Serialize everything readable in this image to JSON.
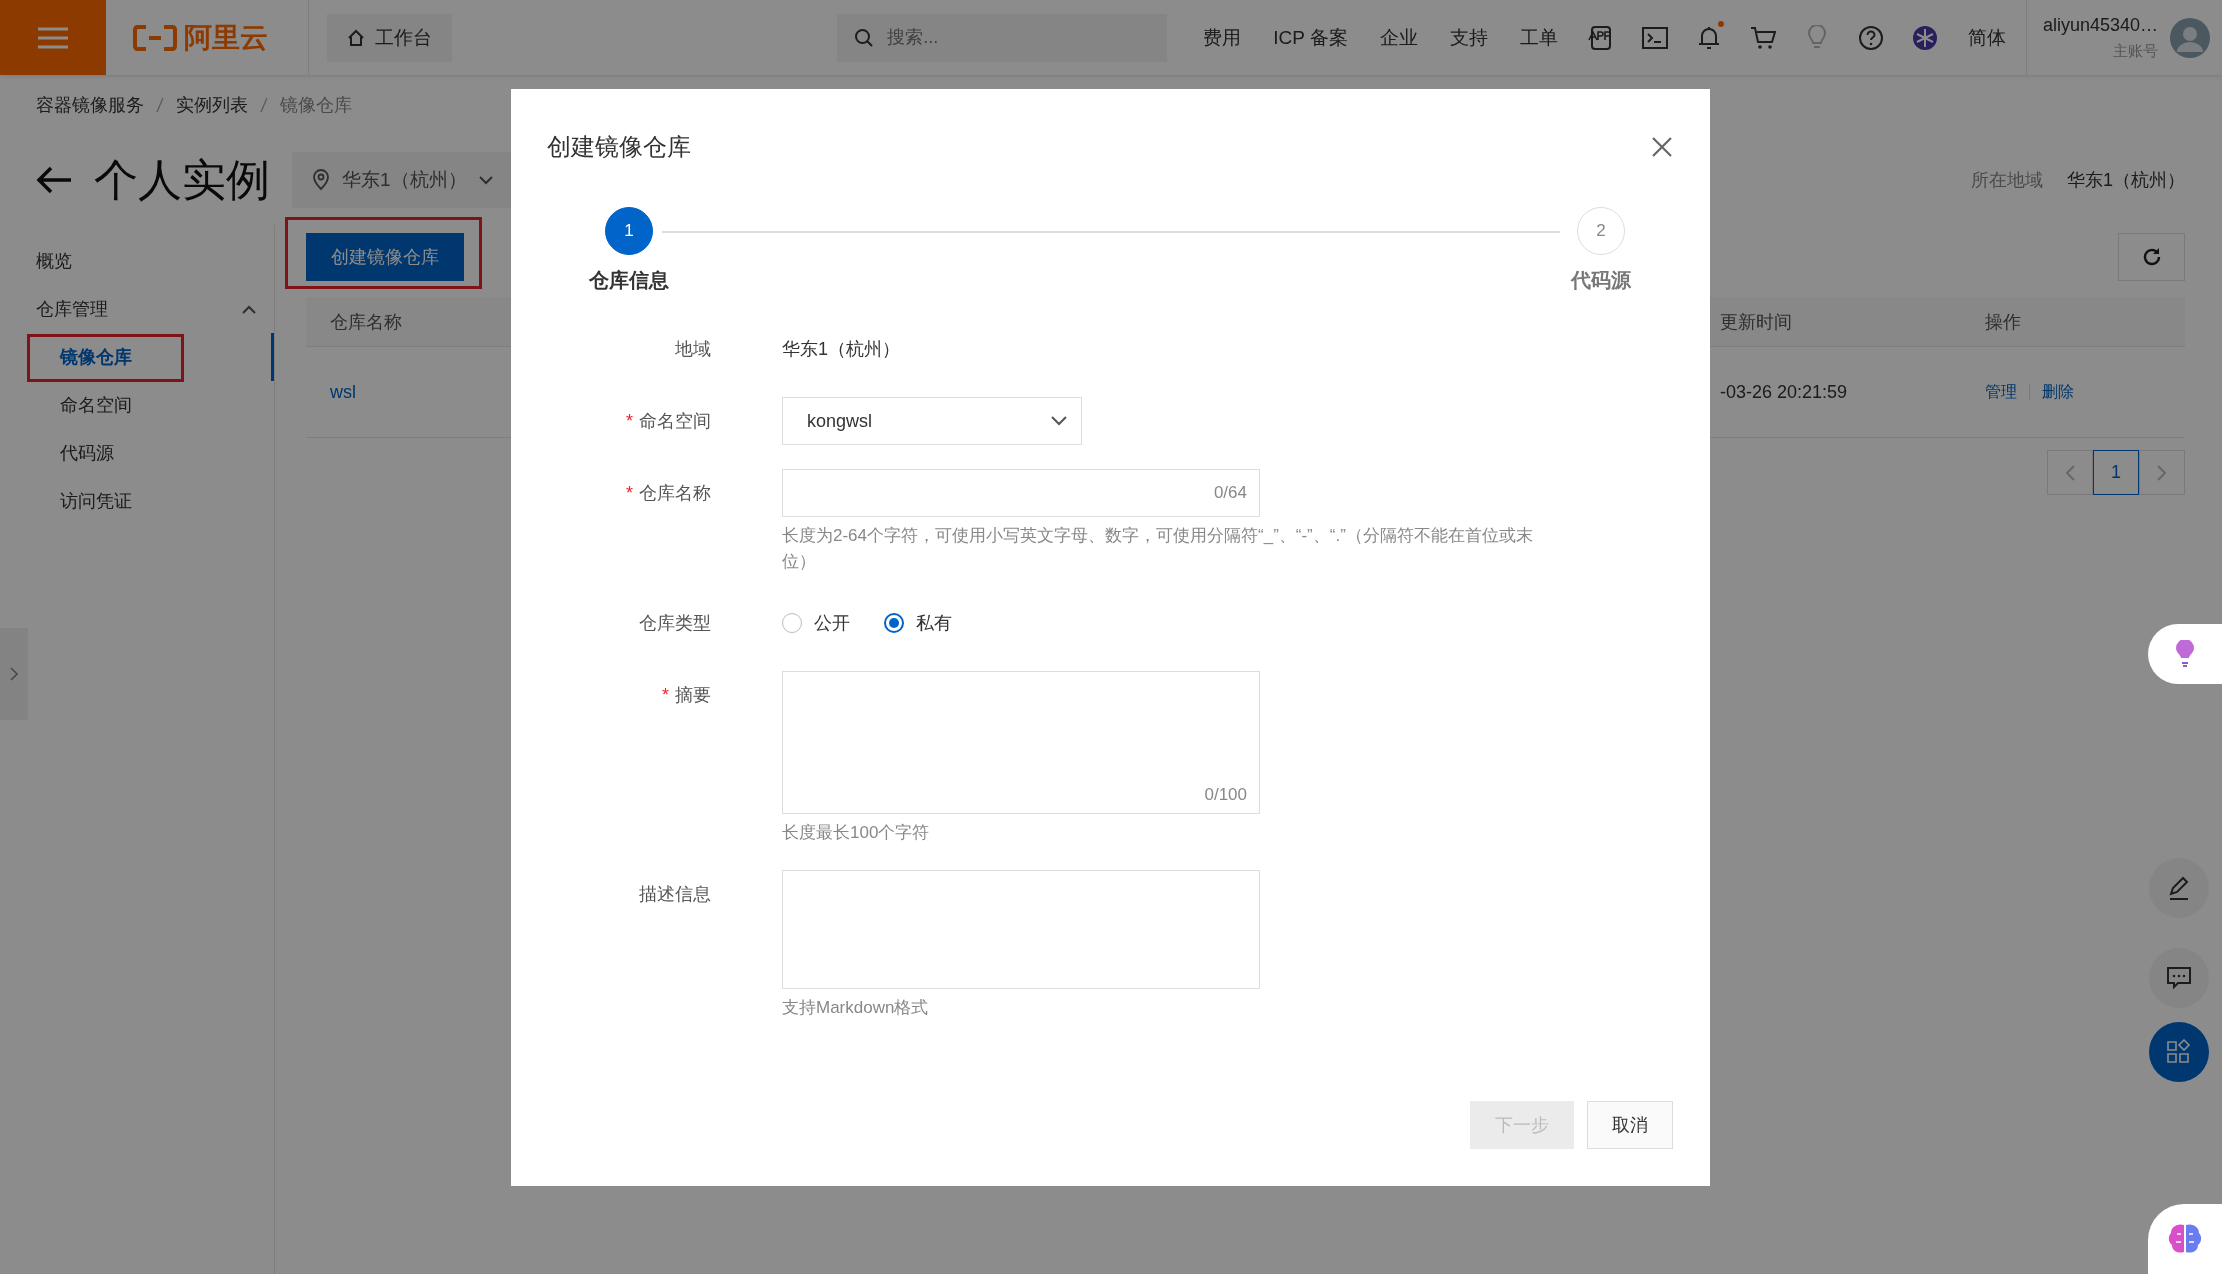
{
  "topbar": {
    "logo": "阿里云",
    "workbench": "工作台",
    "search": {
      "placeholder": "搜索..."
    },
    "nav": [
      "费用",
      "ICP 备案",
      "企业",
      "支持",
      "工单"
    ],
    "icons": [
      {
        "kind": "app",
        "unread": false,
        "disabled": false
      },
      {
        "kind": "terminal",
        "unread": false,
        "disabled": false
      },
      {
        "kind": "bell",
        "unread": true,
        "disabled": false
      },
      {
        "kind": "cart",
        "unread": false,
        "disabled": false
      },
      {
        "kind": "bulb",
        "unread": false,
        "disabled": true
      },
      {
        "kind": "help",
        "unread": false,
        "disabled": false
      },
      {
        "kind": "assistant",
        "unread": false,
        "disabled": false
      }
    ],
    "language": "简体",
    "user": {
      "name": "aliyun45340…",
      "role": "主账号"
    }
  },
  "breadcrumb": [
    "容器镜像服务",
    "实例列表",
    "镜像仓库"
  ],
  "page": {
    "title": "个人实例",
    "region": "华东1（杭州）",
    "region_label": "所在地域",
    "region_value": "华东1（杭州）"
  },
  "sidebar": {
    "items": [
      {
        "label": "概览",
        "selected": false
      },
      {
        "label": "仓库管理",
        "selected": false,
        "expanded": true,
        "children": [
          {
            "label": "镜像仓库",
            "selected": true,
            "annotated": true
          },
          {
            "label": "命名空间",
            "selected": false,
            "annotated": false
          },
          {
            "label": "代码源",
            "selected": false,
            "annotated": false
          },
          {
            "label": "访问凭证",
            "selected": false,
            "annotated": false
          }
        ]
      }
    ]
  },
  "toolbar": {
    "create_button": {
      "label": "创建镜像仓库",
      "annotated": true
    }
  },
  "table": {
    "columns": [
      "仓库名称",
      "更新时间",
      "操作"
    ],
    "rows": [
      {
        "name": "wsl",
        "updated": "-03-26 20:21:59",
        "actions": [
          "管理",
          "删除"
        ]
      }
    ]
  },
  "pagination": {
    "pages": [
      {
        "label": "1",
        "selected": true
      }
    ]
  },
  "dialog": {
    "title": "创建镜像仓库",
    "steps": [
      {
        "number": "1",
        "label": "仓库信息",
        "selected": true
      },
      {
        "number": "2",
        "label": "代码源",
        "selected": false
      }
    ],
    "fields": [
      {
        "kind": "text",
        "label": "地域",
        "value": "华东1（杭州）"
      },
      {
        "kind": "select",
        "label": "命名空间",
        "required_mark": "*",
        "value": "kongwsl"
      },
      {
        "kind": "input",
        "label": "仓库名称",
        "required_mark": "*",
        "counter": "0/64",
        "hint": "长度为2-64个字符，可使用小写英文字母、数字，可使用分隔符“_”、“-”、“.”（分隔符不能在首位或末位）"
      },
      {
        "kind": "radio",
        "label": "仓库类型",
        "options": [
          {
            "label": "公开",
            "selected": false
          },
          {
            "label": "私有",
            "selected": true
          }
        ]
      },
      {
        "kind": "textarea",
        "label": "摘要",
        "required_mark": "*",
        "counter": "0/100",
        "hint": "长度最长100个字符"
      },
      {
        "kind": "textarea",
        "label": "描述信息",
        "hint": "支持Markdown格式"
      }
    ],
    "buttons": [
      {
        "label": "下一步",
        "disabled": true
      },
      {
        "label": "取消",
        "disabled": false
      }
    ]
  }
}
